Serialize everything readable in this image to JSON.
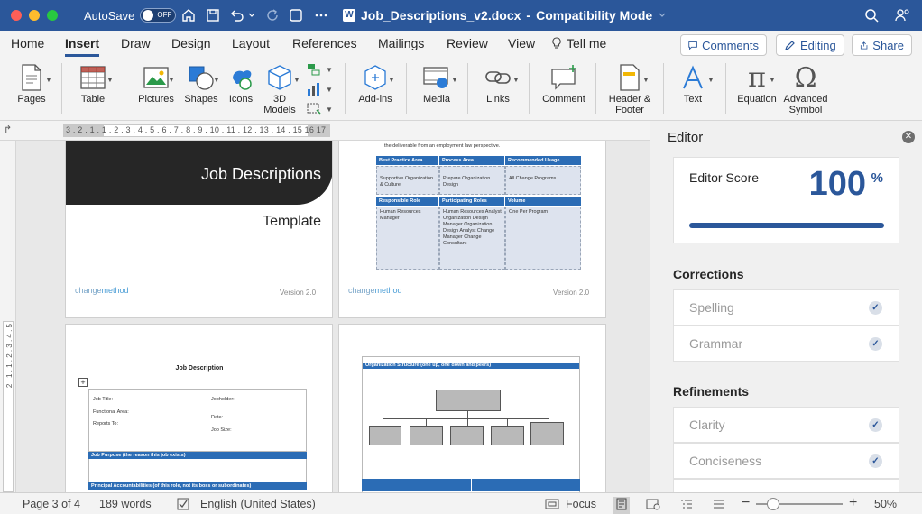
{
  "window": {
    "autosave_label": "AutoSave",
    "autosave_state": "OFF",
    "doc_title": "Job_Descriptions_v2.docx",
    "mode": "Compatibility Mode",
    "separator": "-",
    "word_glyph": "W"
  },
  "tabs": [
    {
      "label": "Home"
    },
    {
      "label": "Insert",
      "active": true
    },
    {
      "label": "Draw"
    },
    {
      "label": "Design"
    },
    {
      "label": "Layout"
    },
    {
      "label": "References"
    },
    {
      "label": "Mailings"
    },
    {
      "label": "Review"
    },
    {
      "label": "View"
    },
    {
      "label": "Tell me"
    }
  ],
  "actions": {
    "comments": "Comments",
    "editing": "Editing",
    "share": "Share"
  },
  "ribbon": {
    "pages": "Pages",
    "table": "Table",
    "pictures": "Pictures",
    "shapes": "Shapes",
    "icons": "Icons",
    "models_line1": "3D",
    "models_line2": "Models",
    "addins": "Add-ins",
    "media": "Media",
    "links": "Links",
    "comment": "Comment",
    "hf_line1": "Header &",
    "hf_line2": "Footer",
    "text": "Text",
    "equation": "Equation",
    "adv_line1": "Advanced",
    "adv_line2": "Symbol"
  },
  "ruler": {
    "ticks": "3 . 2 . 1 . 1 . 2 . 3 . 4 . 5 . 6 . 7 . 8 . 9 . 10 . 11 . 12 . 13 . 14 . 15 16 17"
  },
  "vruler": {
    "ticks": "2 . 1 . 1 . 2 . 3 . 4 . 5"
  },
  "pages": {
    "p1": {
      "title": "Job Descriptions",
      "subtitle": "Template",
      "logo_a": "change",
      "logo_b": "method",
      "version": "Version 2.0"
    },
    "p2": {
      "intro": "the deliverable from an employment law perspective.",
      "h1": "Best Practice Area",
      "h2": "Process Area",
      "h3": "Recommended Usage",
      "c1": "Supportive Organization & Culture",
      "c2": "Prepare Organization Design",
      "c3": "All Change Programs",
      "h4": "Responsible Role",
      "h5": "Participating Roles",
      "h6": "Volume",
      "c4": "Human Resources Manager",
      "c5": "Human Resources Analyst Organization Design Manager Organization Design Analyst Change Manager Change Consultant",
      "c6": "One Per Program",
      "logo_a": "change",
      "logo_b": "method",
      "version": "Version 2.0"
    },
    "p3": {
      "title": "Job Description",
      "job_title": "Job Title:",
      "functional_area": "Functional Area:",
      "reports_to": "Reports To:",
      "jobholder": "Jobholder:",
      "date": "Date:",
      "job_size": "Job Size:",
      "purpose": "Job Purpose (the reason this job exists)",
      "accountabilities": "Principal Accountabilities (of this role, not its boss or subordinates)"
    },
    "p4": {
      "header": "Organization Structure (one up, one down and peers)"
    }
  },
  "editor": {
    "title": "Editor",
    "score_label": "Editor Score",
    "score": "100",
    "score_unit": "%",
    "score_fraction": 1.0,
    "corrections_h": "Corrections",
    "corrections": [
      {
        "label": "Spelling"
      },
      {
        "label": "Grammar"
      }
    ],
    "refinements_h": "Refinements",
    "refinements": [
      {
        "label": "Clarity"
      },
      {
        "label": "Conciseness"
      }
    ]
  },
  "status": {
    "page": "Page 3 of 4",
    "words": "189 words",
    "language": "English (United States)",
    "focus": "Focus",
    "zoom": "50%",
    "zoom_fraction": 0.2
  },
  "colors": {
    "brand": "#2b579a",
    "table_blue": "#2b6cb5"
  }
}
